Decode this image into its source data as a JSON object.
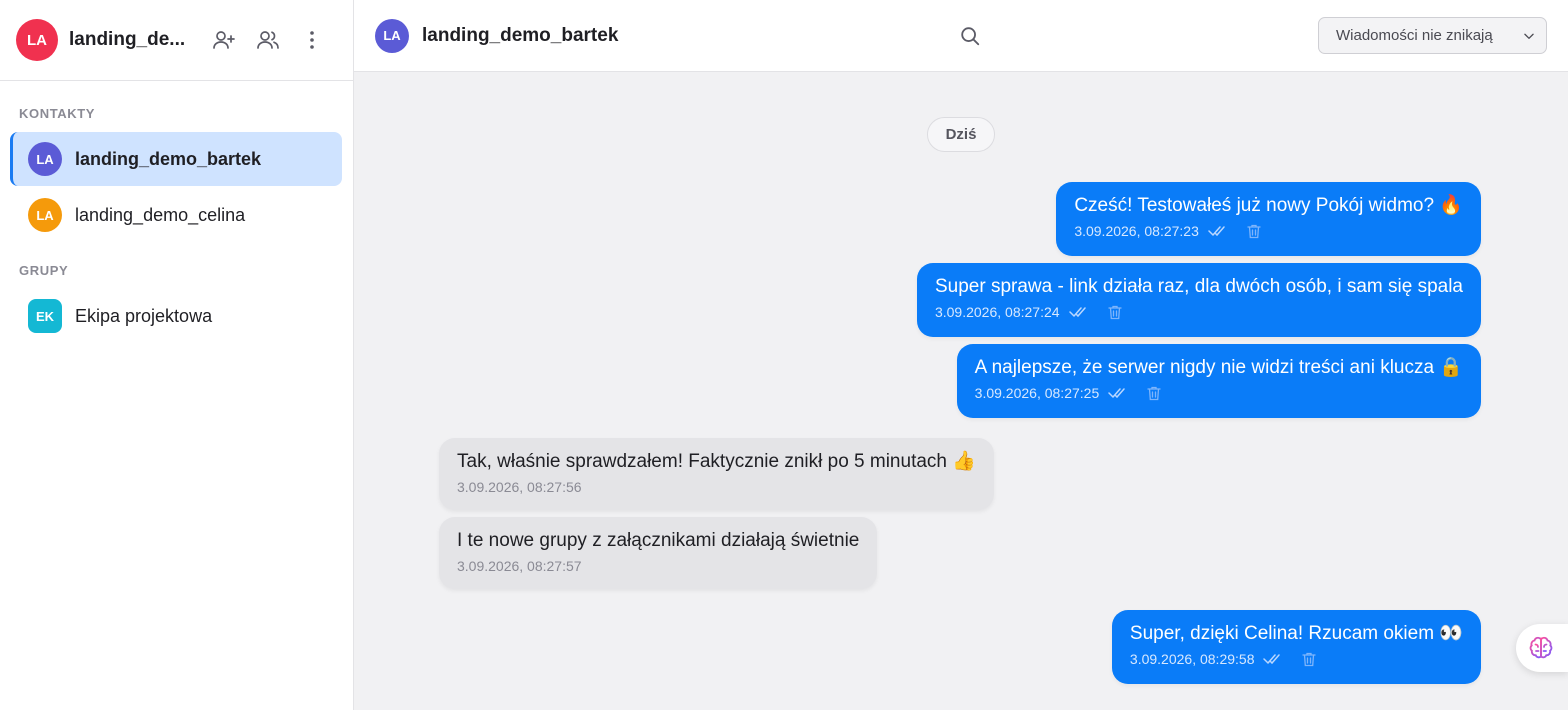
{
  "sidebar": {
    "me": {
      "initials": "LA",
      "name": "landing_de..."
    },
    "contacts_label": "KONTAKTY",
    "groups_label": "GRUPY",
    "contacts": [
      {
        "initials": "LA",
        "name": "landing_demo_bartek",
        "color": "#5b5bd6",
        "active": true
      },
      {
        "initials": "LA",
        "name": "landing_demo_celina",
        "color": "#f59a0b",
        "active": false
      }
    ],
    "groups": [
      {
        "initials": "EK",
        "name": "Ekipa projektowa",
        "color": "#14b8d4"
      }
    ]
  },
  "chat": {
    "avatar_initials": "LA",
    "title": "landing_demo_bartek",
    "disappearing_select": "Wiadomości nie znikają",
    "day_label": "Dziś",
    "messages": [
      {
        "dir": "out",
        "text": "Cześć! Testowałeś już nowy Pokój widmo? 🔥",
        "time": "3.09.2026, 08:27:23"
      },
      {
        "dir": "out",
        "text": "Super sprawa - link działa raz, dla dwóch osób, i sam się spala",
        "time": "3.09.2026, 08:27:24"
      },
      {
        "dir": "out",
        "text": "A najlepsze, że serwer nigdy nie widzi treści ani klucza 🔒",
        "time": "3.09.2026, 08:27:25"
      },
      {
        "dir": "in",
        "text": "Tak, właśnie sprawdzałem! Faktycznie znikł po 5 minutach 👍",
        "time": "3.09.2026, 08:27:56"
      },
      {
        "dir": "in",
        "text": "I te nowe grupy z załącznikami działają świetnie",
        "time": "3.09.2026, 08:27:57"
      },
      {
        "dir": "out",
        "text": "Super, dzięki Celina! Rzucam okiem 👀",
        "time": "3.09.2026, 08:29:58"
      }
    ]
  },
  "colors": {
    "accent": "#0a7cf8",
    "me_avatar": "#f0314f",
    "active_item": "#cfe3ff"
  },
  "icons": [
    "add-user-icon",
    "users-icon",
    "more-vertical-icon",
    "search-icon",
    "chevron-down-icon",
    "double-check-icon",
    "trash-icon",
    "brain-icon"
  ]
}
